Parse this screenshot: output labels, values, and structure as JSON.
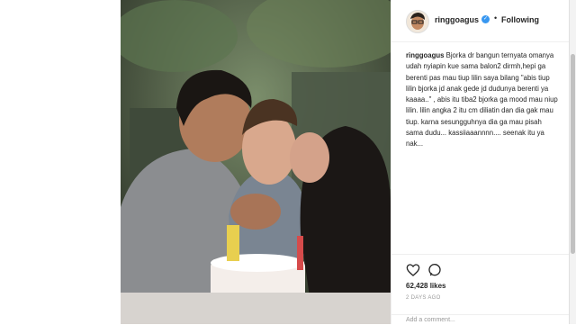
{
  "post": {
    "username": "ringgoagus",
    "follow_separator": "•",
    "follow_label": "Following",
    "caption_user": "ringgoagus",
    "caption_text": "Bjorka dr bangun ternyata omanya udah nyiapin kue sama balon2 dirmh,hepi ga berenti pas mau tiup lilin saya bilang \"abis tiup lilin bjorka jd anak gede jd dudunya berenti ya kaaaa..\" , abis itu tiba2 bjorka ga mood mau niup lilin. lilin angka 2 itu cm diliatin dan dia gak mau tiup. karna sesungguhnya dia ga mau pisah sama dudu... kassiiaaannnn.... seenak itu ya nak...",
    "likes": "62,428 likes",
    "time": "2 DAYS AGO",
    "comment_placeholder": "Add a comment..."
  },
  "icons": {
    "verified": "verified-badge",
    "like": "heart-icon",
    "comment": "comment-icon"
  },
  "colors": {
    "verified": "#3897f0",
    "text": "#262626",
    "muted": "#999999"
  }
}
